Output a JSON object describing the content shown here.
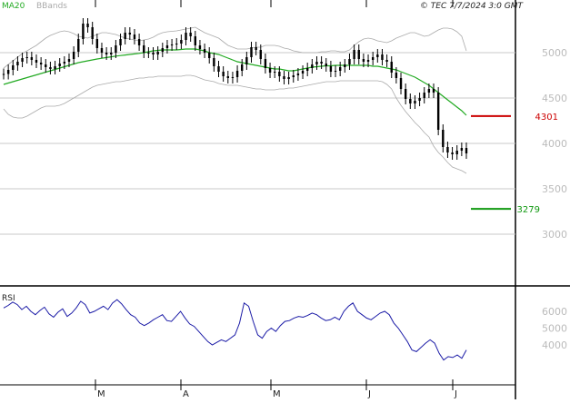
{
  "header": {
    "legend_ma": "MA20",
    "legend_bbands": "BBands",
    "copyright": "© TEC 7/7/2024 3:0 GMT"
  },
  "rsi_label": "RSI",
  "colors": {
    "candle": "#000000",
    "ma": "#22aa22",
    "bbands": "#aaaaaa",
    "rsi": "#1a1aa6",
    "resistance": "#cc0000",
    "support": "#119911",
    "grid": "#c8c8c8",
    "bg": "#ffffff"
  },
  "chart_data": [
    {
      "type": "candlestick",
      "title": "",
      "ylim": [
        2500,
        5550
      ],
      "y_ticks": [
        3000,
        3500,
        4000,
        4500,
        5000
      ],
      "x_ticks": [
        "M",
        "A",
        "M",
        "J",
        "J"
      ],
      "price_series": [
        4765,
        4810,
        4860,
        4900,
        4940,
        4950,
        4920,
        4890,
        4870,
        4840,
        4820,
        4850,
        4880,
        4900,
        4930,
        5010,
        5150,
        5320,
        5280,
        5150,
        5050,
        5000,
        4980,
        5000,
        5080,
        5150,
        5220,
        5200,
        5150,
        5080,
        5000,
        5000,
        4980,
        5010,
        5050,
        5080,
        5090,
        5100,
        5140,
        5220,
        5180,
        5080,
        5040,
        5000,
        4940,
        4850,
        4790,
        4740,
        4720,
        4730,
        4800,
        4870,
        4950,
        5060,
        5030,
        4930,
        4830,
        4780,
        4790,
        4740,
        4710,
        4730,
        4750,
        4770,
        4800,
        4830,
        4870,
        4900,
        4880,
        4850,
        4790,
        4800,
        4840,
        4870,
        4930,
        5030,
        4930,
        4900,
        4920,
        4950,
        4980,
        4920,
        4900,
        4780,
        4720,
        4600,
        4490,
        4440,
        4470,
        4500,
        4560,
        4600,
        4560,
        4150,
        3960,
        3900,
        3880,
        3920,
        3950,
        3890
      ],
      "ma20": [
        4650,
        4665,
        4680,
        4695,
        4710,
        4725,
        4740,
        4755,
        4770,
        4785,
        4800,
        4815,
        4830,
        4845,
        4860,
        4875,
        4890,
        4900,
        4910,
        4920,
        4930,
        4938,
        4946,
        4954,
        4962,
        4968,
        4974,
        4980,
        4986,
        4992,
        5000,
        5010,
        5020,
        5025,
        5030,
        5030,
        5030,
        5030,
        5035,
        5040,
        5040,
        5040,
        5030,
        5020,
        5000,
        4990,
        4980,
        4960,
        4940,
        4920,
        4900,
        4890,
        4880,
        4870,
        4860,
        4850,
        4840,
        4830,
        4820,
        4820,
        4810,
        4800,
        4800,
        4810,
        4820,
        4830,
        4840,
        4845,
        4850,
        4855,
        4855,
        4860,
        4860,
        4860,
        4860,
        4860,
        4860,
        4860,
        4860,
        4850,
        4850,
        4840,
        4830,
        4820,
        4810,
        4790,
        4770,
        4750,
        4730,
        4700,
        4670,
        4640,
        4600,
        4560,
        4520,
        4480,
        4440,
        4400,
        4360,
        4310
      ],
      "bb_upper": [
        4830,
        4870,
        4910,
        4950,
        4990,
        5020,
        5050,
        5080,
        5120,
        5160,
        5190,
        5210,
        5230,
        5240,
        5230,
        5210,
        5180,
        5170,
        5160,
        5180,
        5200,
        5220,
        5220,
        5210,
        5200,
        5180,
        5160,
        5150,
        5140,
        5130,
        5140,
        5150,
        5170,
        5200,
        5220,
        5230,
        5235,
        5240,
        5250,
        5260,
        5270,
        5280,
        5250,
        5220,
        5200,
        5180,
        5160,
        5120,
        5080,
        5060,
        5040,
        5040,
        5040,
        5050,
        5060,
        5060,
        5080,
        5080,
        5080,
        5070,
        5050,
        5040,
        5020,
        5010,
        5000,
        5000,
        5000,
        5000,
        5010,
        5010,
        5020,
        5020,
        5010,
        5010,
        5030,
        5080,
        5120,
        5150,
        5160,
        5150,
        5130,
        5120,
        5110,
        5130,
        5160,
        5180,
        5200,
        5220,
        5220,
        5200,
        5180,
        5190,
        5220,
        5250,
        5270,
        5270,
        5260,
        5230,
        5180,
        5020
      ],
      "bb_lower": [
        4380,
        4320,
        4290,
        4280,
        4280,
        4300,
        4330,
        4360,
        4390,
        4410,
        4410,
        4410,
        4420,
        4440,
        4470,
        4500,
        4530,
        4560,
        4590,
        4620,
        4640,
        4650,
        4660,
        4670,
        4680,
        4680,
        4690,
        4700,
        4710,
        4720,
        4720,
        4730,
        4730,
        4740,
        4740,
        4740,
        4740,
        4740,
        4740,
        4750,
        4750,
        4740,
        4720,
        4700,
        4690,
        4680,
        4660,
        4650,
        4640,
        4640,
        4640,
        4630,
        4620,
        4610,
        4600,
        4600,
        4590,
        4590,
        4590,
        4600,
        4600,
        4610,
        4610,
        4620,
        4630,
        4640,
        4650,
        4660,
        4670,
        4680,
        4680,
        4680,
        4690,
        4690,
        4690,
        4690,
        4690,
        4690,
        4690,
        4690,
        4690,
        4680,
        4650,
        4600,
        4500,
        4420,
        4350,
        4290,
        4230,
        4180,
        4120,
        4070,
        3970,
        3900,
        3850,
        3790,
        3740,
        3720,
        3700,
        3670
      ],
      "levels": [
        {
          "name": "resistance",
          "value": "4301",
          "y": 4301
        },
        {
          "name": "support",
          "value": "3279",
          "y": 3279
        }
      ]
    },
    {
      "type": "line",
      "title": "",
      "ylim": [
        2800,
        7200
      ],
      "y_ticks": [
        4000,
        5000,
        6000
      ],
      "rsi_values": [
        6200,
        6350,
        6550,
        6400,
        6100,
        6300,
        6000,
        5800,
        6050,
        6250,
        5850,
        5650,
        5950,
        6150,
        5700,
        5900,
        6200,
        6600,
        6400,
        5900,
        6000,
        6150,
        6300,
        6100,
        6500,
        6700,
        6450,
        6100,
        5800,
        5650,
        5300,
        5150,
        5300,
        5500,
        5650,
        5800,
        5450,
        5400,
        5700,
        6000,
        5600,
        5250,
        5100,
        4800,
        4500,
        4200,
        4000,
        4150,
        4300,
        4200,
        4400,
        4600,
        5300,
        6500,
        6300,
        5400,
        4600,
        4400,
        4800,
        5000,
        4800,
        5150,
        5400,
        5450,
        5600,
        5700,
        5650,
        5750,
        5900,
        5800,
        5600,
        5450,
        5500,
        5650,
        5500,
        6000,
        6300,
        6500,
        6000,
        5800,
        5600,
        5500,
        5700,
        5900,
        6000,
        5800,
        5300,
        5000,
        4600,
        4200,
        3700,
        3600,
        3850,
        4100,
        4300,
        4100,
        3500,
        3100,
        3300,
        3250,
        3400,
        3200,
        3700
      ]
    }
  ]
}
